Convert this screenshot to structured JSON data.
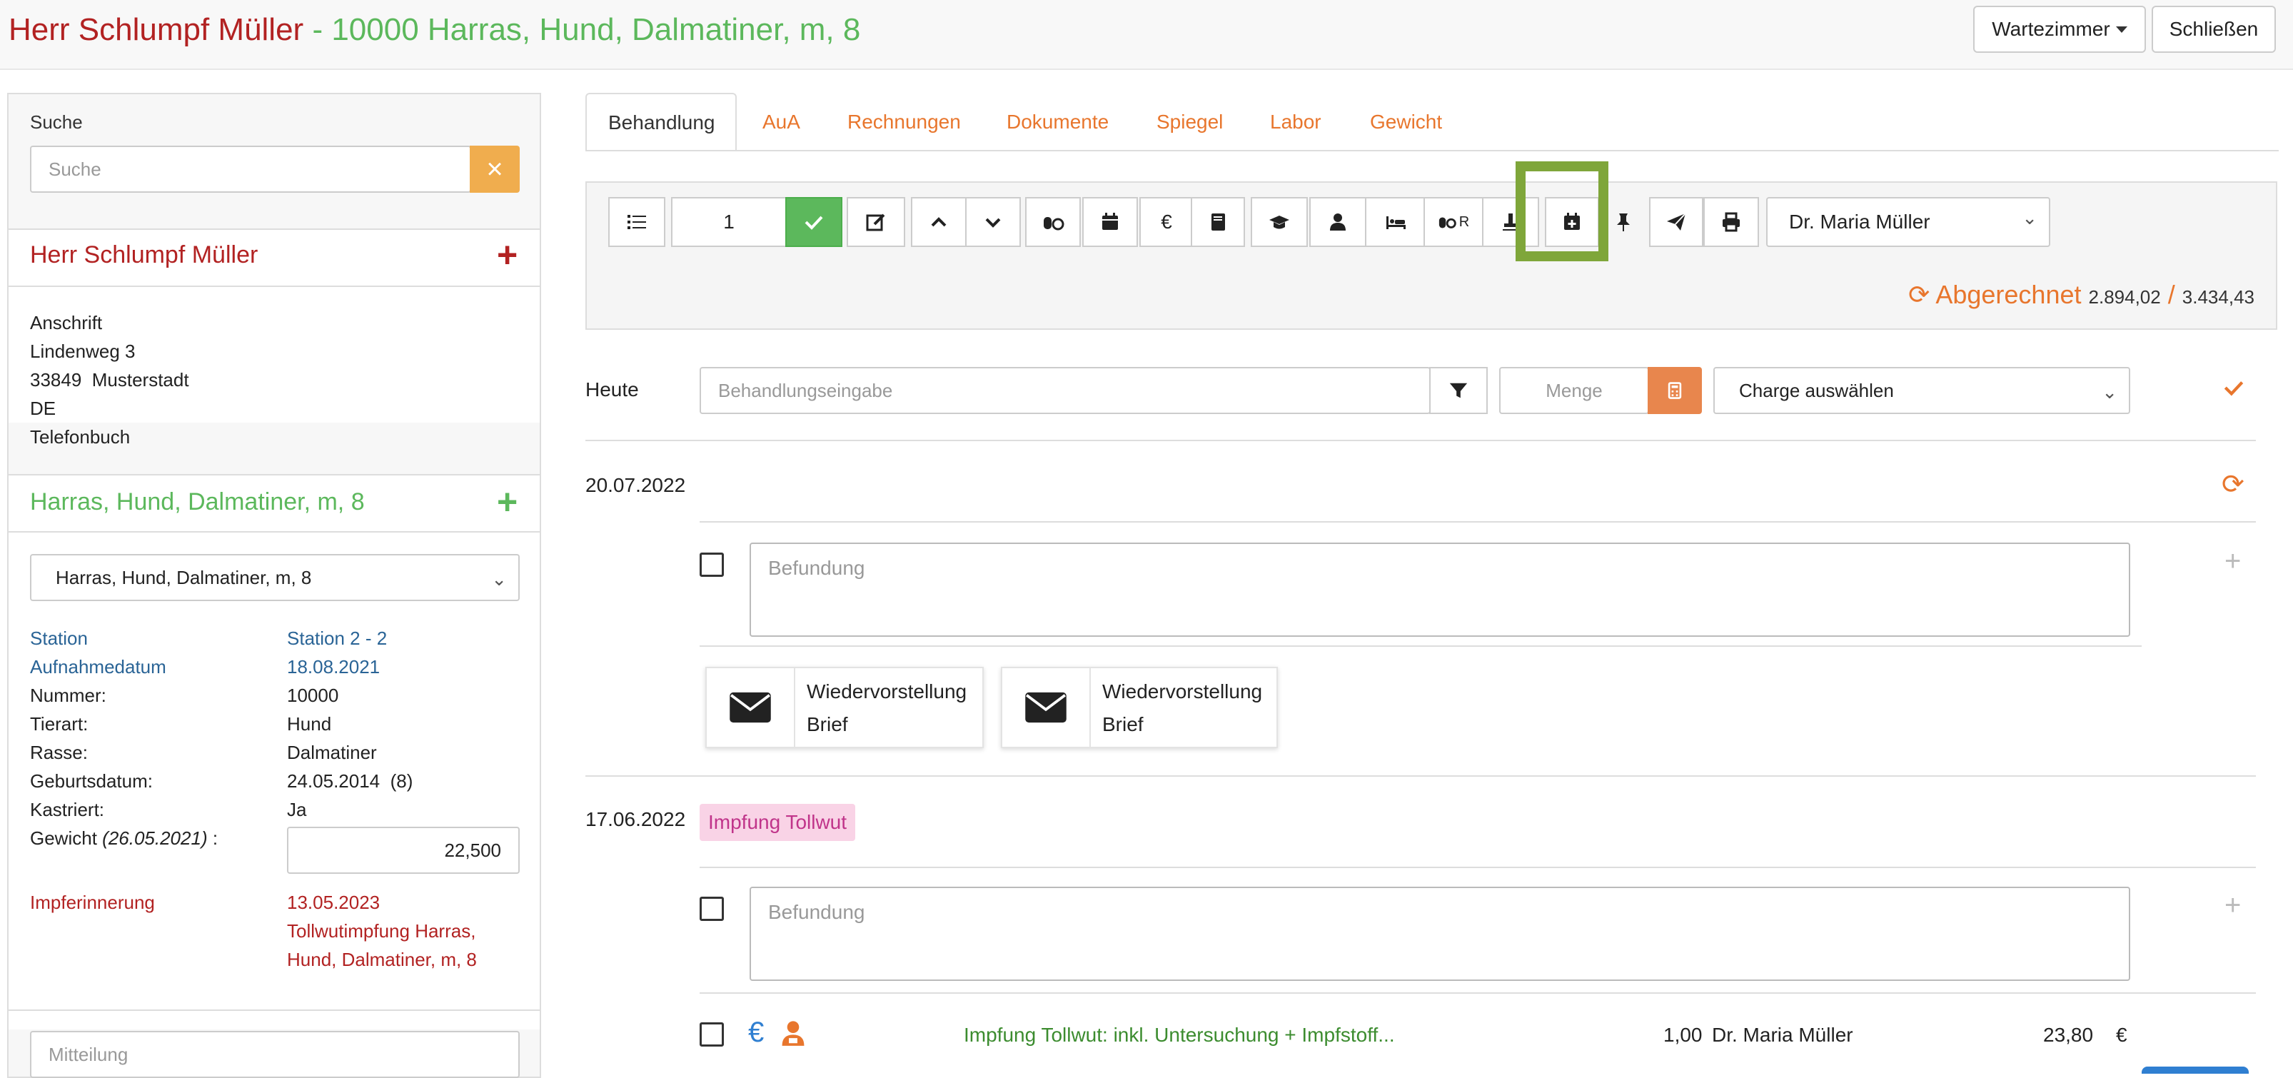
{
  "header": {
    "owner": "Herr Schlumpf Müller",
    "separator": " - ",
    "patient": "10000 Harras, Hund, Dalmatiner, m, 8",
    "waiting_room_label": "Wartezimmer",
    "close_label": "Schließen"
  },
  "sidebar": {
    "search_label": "Suche",
    "search_placeholder": "Suche",
    "clear_icon": "×",
    "owner_name": "Herr Schlumpf Müller",
    "address": {
      "heading": "Anschrift",
      "street": "Lindenweg 3",
      "city": "33849  Musterstadt",
      "country": "DE",
      "phonebook": "Telefonbuch"
    },
    "patient_name": "Harras, Hund, Dalmatiner, m, 8",
    "patient_select_value": "Harras, Hund, Dalmatiner, m, 8",
    "details": [
      {
        "label": "Station",
        "value": "Station 2 - 2"
      },
      {
        "label": "Aufnahmedatum",
        "value": "18.08.2021"
      },
      {
        "label": "Nummer:",
        "value": "10000"
      },
      {
        "label": "Tierart:",
        "value": "Hund"
      },
      {
        "label": "Rasse:",
        "value": "Dalmatiner"
      },
      {
        "label": "Geburtsdatum:",
        "value": "24.05.2014  (8)"
      },
      {
        "label": "Kastriert:",
        "value": "Ja"
      }
    ],
    "weight_label": "Gewicht",
    "weight_date": "(26.05.2021)",
    "weight_colon": " :",
    "weight_value": "22,500",
    "vaccination_label": "Impferinnerung",
    "vaccination_date": "13.05.2023",
    "vaccination_text": "Tollwutimpfung Harras, Hund, Dalmatiner, m, 8",
    "message_placeholder": "Mitteilung"
  },
  "tabs": [
    "Behandlung",
    "AuA",
    "Rechnungen",
    "Dokumente",
    "Spiegel",
    "Labor",
    "Gewicht"
  ],
  "toolbar": {
    "quantity": "1",
    "doctor_select": "Dr. Maria Müller",
    "billed_label": "Abgerechnet",
    "billed_value": "2.894,02",
    "billed_sep": "/",
    "billed_total": "3.434,43",
    "superscript_r": "R"
  },
  "entry": {
    "today_label": "Heute",
    "treatment_placeholder": "Behandlungseingabe",
    "amount_placeholder": "Menge",
    "charge_select": "Charge auswählen"
  },
  "timeline": [
    {
      "date": "20.07.2022",
      "finding_placeholder": "Befundung",
      "cards": [
        {
          "line1": "Wiedervorstellung",
          "line2": "Brief"
        },
        {
          "line1": "Wiedervorstellung",
          "line2": "Brief"
        }
      ]
    },
    {
      "date": "17.06.2022",
      "badge": "Impfung Tollwut",
      "finding_placeholder": "Befundung",
      "item": {
        "description": "Impfung Tollwut: inkl. Untersuchung + Impfstoff...",
        "quantity": "1,00",
        "doctor": "Dr. Maria Müller",
        "price": "23,80",
        "currency": "€"
      }
    }
  ],
  "colors": {
    "brand_red": "#b22222",
    "brand_green": "#5cb85c",
    "accent_orange": "#e8762d",
    "highlight": "#7fa63a",
    "link_blue": "#2a6496"
  }
}
